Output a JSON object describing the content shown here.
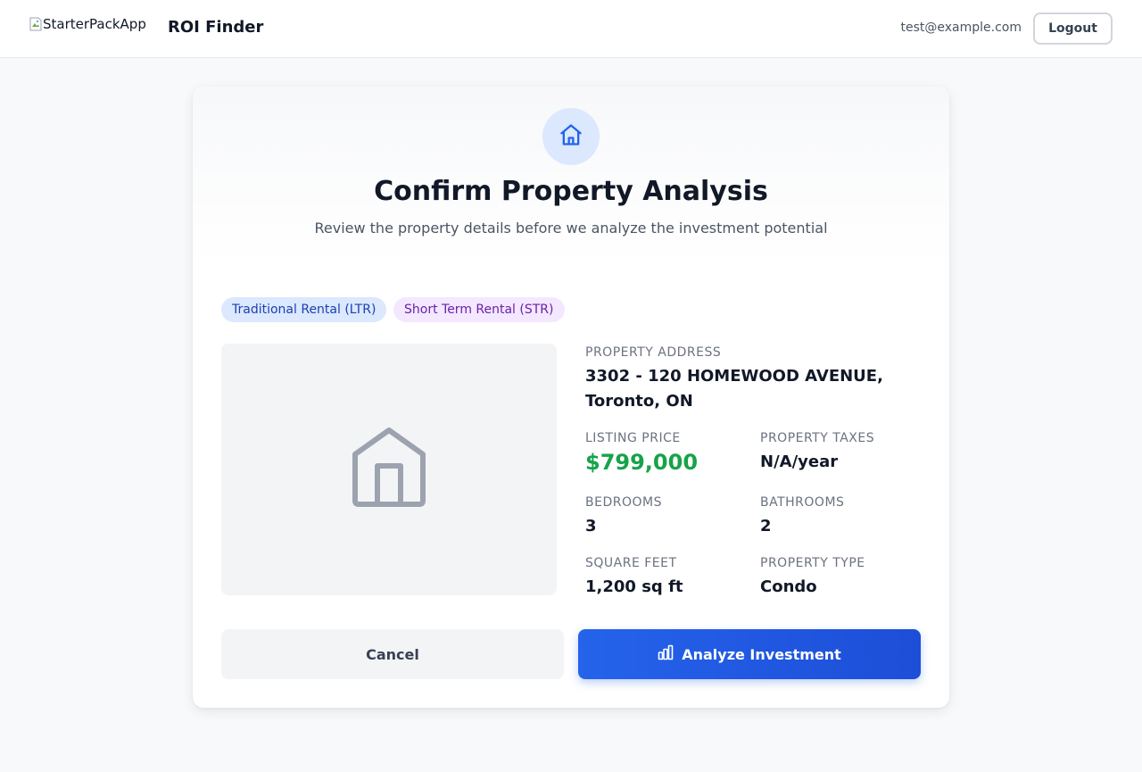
{
  "header": {
    "logo_alt": "StarterPackApp",
    "app_title": "ROI Finder",
    "user_email": "test@example.com",
    "logout_label": "Logout"
  },
  "card": {
    "title": "Confirm Property Analysis",
    "subtitle": "Review the property details before we analyze the investment potential",
    "header_icon": "home-icon",
    "badges": [
      {
        "label": "Traditional Rental (LTR)",
        "color": "#1e40af",
        "background": "#dbe8fe"
      },
      {
        "label": "Short Term Rental (STR)",
        "color": "#6b21a8",
        "background": "#f3e8ff"
      }
    ],
    "photo_placeholder_icon": "home-icon"
  },
  "property": {
    "address_label": "PROPERTY ADDRESS",
    "address_line1": "3302 - 120 HOMEWOOD AVENUE,",
    "address_line2": "Toronto, ON",
    "price_label": "LISTING PRICE",
    "price": "$799,000",
    "taxes_label": "PROPERTY TAXES",
    "taxes": "N/A/year",
    "bedrooms_label": "BEDROOMS",
    "bedrooms": "3",
    "bathrooms_label": "BATHROOMS",
    "bathrooms": "2",
    "sqft_label": "SQUARE FEET",
    "sqft": "1,200 sq ft",
    "type_label": "PROPERTY TYPE",
    "type": "Condo"
  },
  "actions": {
    "cancel_label": "Cancel",
    "analyze_label": "Analyze Investment",
    "analyze_icon": "bar-chart-icon"
  },
  "colors": {
    "primary": "#2563eb",
    "price_green": "#16a34a",
    "background": "#f8f9fb"
  }
}
